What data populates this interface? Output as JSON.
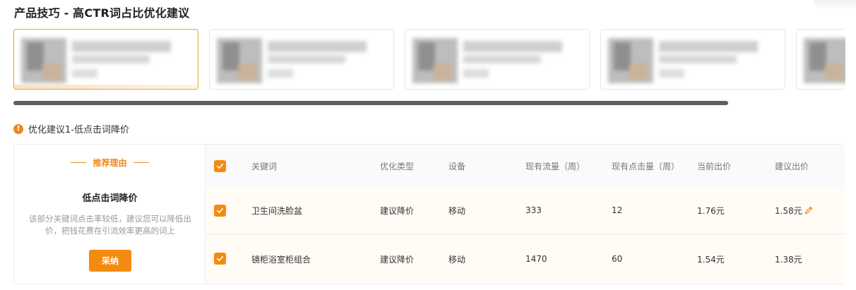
{
  "page": {
    "title": "产品技巧 - 高CTR词占比优化建议"
  },
  "hint": {
    "icon": "info-icon",
    "text": "优化建议1-低点击词降价"
  },
  "reason": {
    "heading": "推荐理由",
    "title": "低点击词降价",
    "desc_line1": "该部分关键词点击率较低，建议您可以降低出",
    "desc_line2": "价，把钱花费在引流效率更高的词上",
    "adopt_label": "采纳"
  },
  "table": {
    "headers": {
      "keyword": "关键词",
      "type": "优化类型",
      "device": "设备",
      "traffic": "现有流量（周）",
      "clicks": "现有点击量（周）",
      "current_bid": "当前出价",
      "suggested_bid": "建议出价"
    },
    "rows": [
      {
        "keyword": "卫生间洗脸盆",
        "type": "建议降价",
        "device": "移动",
        "traffic": "333",
        "clicks": "12",
        "current_bid": "1.76元",
        "suggested_bid": "1.58元"
      },
      {
        "keyword": "镜柜浴室柜组合",
        "type": "建议降价",
        "device": "移动",
        "traffic": "1470",
        "clicks": "60",
        "current_bid": "1.54元",
        "suggested_bid": "1.38元"
      }
    ]
  },
  "colors": {
    "accent": "#f58a10",
    "selected_border": "#e8a23b"
  }
}
